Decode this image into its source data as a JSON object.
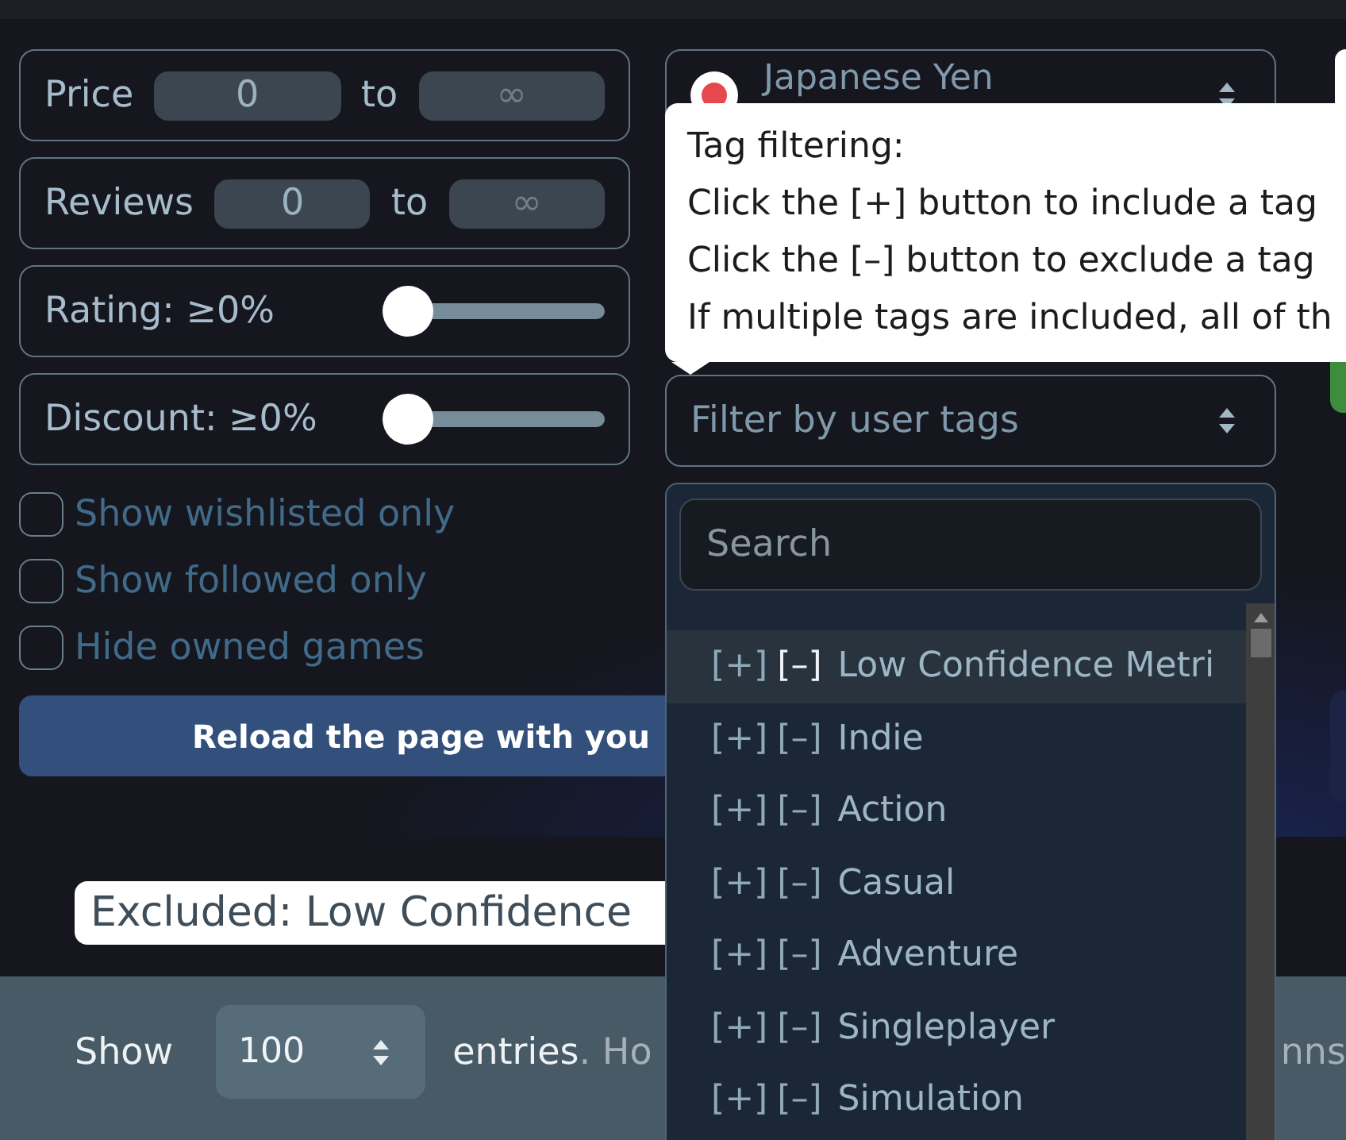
{
  "filters": [
    {
      "kind": "range",
      "label": "Price",
      "min_value": "0",
      "separator": "to",
      "max_placeholder": "∞"
    },
    {
      "kind": "range",
      "label": "Reviews",
      "min_value": "0",
      "separator": "to",
      "max_placeholder": "∞"
    },
    {
      "kind": "slider",
      "label": "Rating: ≥0%",
      "level": 0
    },
    {
      "kind": "slider",
      "label": "Discount: ≥0%",
      "level": 0
    }
  ],
  "checkboxes": [
    {
      "label": "Show wishlisted only",
      "checked": false
    },
    {
      "label": "Show followed only",
      "checked": false
    },
    {
      "label": "Hide owned games",
      "checked": false
    }
  ],
  "reload_button": {
    "label": "Reload the page with you"
  },
  "currency_select": {
    "value": "Japanese Yen"
  },
  "tooltip": {
    "lines": [
      "Tag filtering:",
      "Click the [+] button to include a tag",
      "Click the [–] button to exclude a tag",
      "If multiple tags are included, all of th"
    ]
  },
  "tag_select": {
    "placeholder": "Filter by user tags"
  },
  "tag_dropdown": {
    "search": {
      "placeholder": "Search"
    },
    "items": [
      {
        "include": "[+]",
        "exclude": "[–]",
        "label": "Low Confidence Metri",
        "highlighted": true
      },
      {
        "include": "[+]",
        "exclude": "[–]",
        "label": "Indie",
        "highlighted": false
      },
      {
        "include": "[+]",
        "exclude": "[–]",
        "label": "Action",
        "highlighted": false
      },
      {
        "include": "[+]",
        "exclude": "[–]",
        "label": "Casual",
        "highlighted": false
      },
      {
        "include": "[+]",
        "exclude": "[–]",
        "label": "Adventure",
        "highlighted": false
      },
      {
        "include": "[+]",
        "exclude": "[–]",
        "label": "Singleplayer",
        "highlighted": false
      },
      {
        "include": "[+]",
        "exclude": "[–]",
        "label": "Simulation",
        "highlighted": false
      }
    ]
  },
  "excluded_tags": {
    "text": "Excluded: Low Confidence"
  },
  "footer": {
    "show_label": "Show",
    "page_size": "100",
    "entries_label": "entries",
    "hint": ". Ho",
    "hint_tail": "nns"
  }
}
